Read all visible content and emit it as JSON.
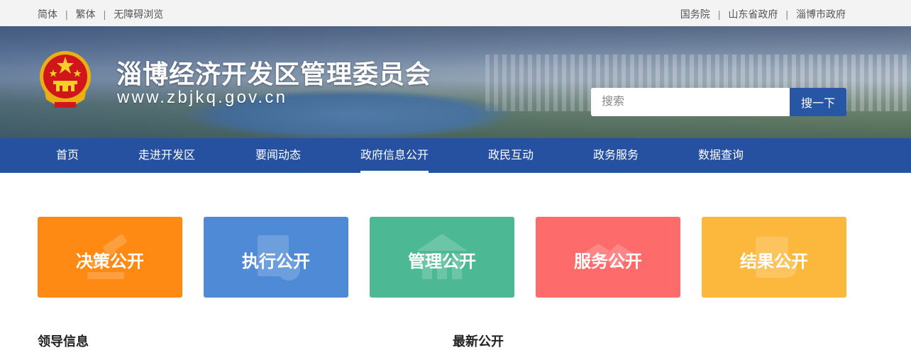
{
  "topbar": {
    "left_links": [
      "简体",
      "繁体",
      "无障碍浏览"
    ],
    "right_links": [
      "国务院",
      "山东省政府",
      "淄博市政府"
    ]
  },
  "header": {
    "title": "淄博经济开发区管理委员会",
    "url": "www.zbjkq.gov.cn",
    "emblem_icon": "national-emblem-icon"
  },
  "search": {
    "placeholder": "搜索",
    "button_label": "搜一下"
  },
  "nav": {
    "items": [
      "首页",
      "走进开发区",
      "要闻动态",
      "政府信息公开",
      "政民互动",
      "政务服务",
      "数据查询"
    ],
    "active": "政府信息公开"
  },
  "tiles": [
    {
      "label": "决策公开",
      "color": "#fe8a14",
      "icon": "gavel-icon"
    },
    {
      "label": "执行公开",
      "color": "#4e8ad6",
      "icon": "document-icon"
    },
    {
      "label": "管理公开",
      "color": "#4cb994",
      "icon": "building-icon"
    },
    {
      "label": "服务公开",
      "color": "#fd6b6b",
      "icon": "handshake-icon"
    },
    {
      "label": "结果公开",
      "color": "#fbb83c",
      "icon": "result-icon"
    }
  ],
  "sections": [
    "领导信息",
    "最新公开"
  ],
  "colors": {
    "nav_bg": "#2551a0",
    "search_button": "#2756a5",
    "topbar_bg": "#f3f3f3"
  }
}
